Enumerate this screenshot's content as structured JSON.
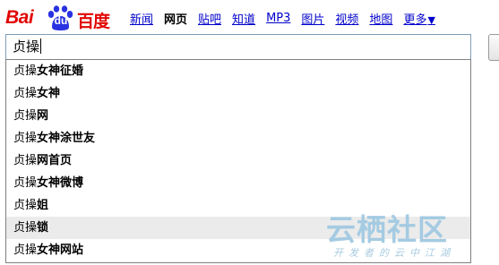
{
  "logo": {
    "bai": "Bai",
    "du": "du",
    "cn": "百度"
  },
  "nav": {
    "items": [
      {
        "label": "新闻",
        "active": false
      },
      {
        "label": "网页",
        "active": true
      },
      {
        "label": "贴吧",
        "active": false
      },
      {
        "label": "知道",
        "active": false
      },
      {
        "label": "MP3",
        "active": false
      },
      {
        "label": "图片",
        "active": false
      },
      {
        "label": "视频",
        "active": false
      },
      {
        "label": "地图",
        "active": false
      }
    ],
    "more_label": "更多",
    "more_arrow": "▼"
  },
  "search": {
    "value": "贞操"
  },
  "suggestions": {
    "items": [
      {
        "query": "贞操",
        "rest": "女神征婚"
      },
      {
        "query": "贞操",
        "rest": "女神"
      },
      {
        "query": "贞操",
        "rest": "网"
      },
      {
        "query": "贞操",
        "rest": "女神涂世友"
      },
      {
        "query": "贞操",
        "rest": "网首页"
      },
      {
        "query": "贞操",
        "rest": "女神微博"
      },
      {
        "query": "贞操",
        "rest": "姐"
      },
      {
        "query": "贞操",
        "rest": "锁"
      },
      {
        "query": "贞操",
        "rest": "女神网站"
      }
    ],
    "highlighted_index": 7
  },
  "watermark": {
    "main": "云栖社区",
    "sub": "开发者的云中江湖"
  },
  "colors": {
    "brand_red": "#e10602",
    "brand_blue": "#2932e1",
    "link": "#0000cc",
    "highlight_row": "#ebebeb",
    "watermark": "#a4cbe2"
  }
}
